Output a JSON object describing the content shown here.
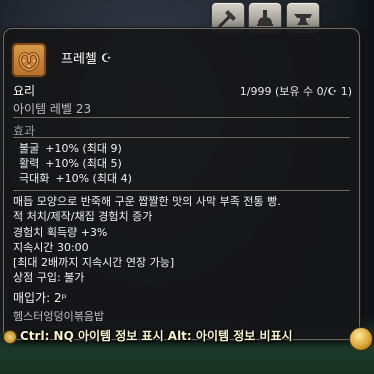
{
  "toolbar": {
    "buttons": [
      {
        "icon": "hammer-icon"
      },
      {
        "icon": "alembic-icon"
      },
      {
        "icon": "anvil-icon"
      }
    ]
  },
  "tooltip": {
    "item_name": "프레첼",
    "hq_mark": "☪",
    "category": "요리",
    "stack_info": "1/999 (보유 수 0/☪ 1)",
    "item_level": "아이템 레벨 23",
    "effects_label": "효과",
    "effects": [
      {
        "stat": "불굴",
        "value": "+10% (최대 9)"
      },
      {
        "stat": "활력",
        "value": "+10% (최대 5)"
      },
      {
        "stat": "극대화",
        "value": "+10% (최대 4)"
      }
    ],
    "description": [
      "매듭 모양으로 반죽해 구운 짭짤한 맛의 사막 부족 전통 빵.",
      "적 처치/제작/채집 경험치 증가",
      "경험치 획득량 +3%",
      "지속시간 30:00",
      "[최대 2배까지 지속시간 연장 가능]",
      "상점 구입: 불가"
    ],
    "sell_price": "매입가: 2ᵖ",
    "crafter_name": "헴스터엉덩이볶음밥"
  },
  "hint_bar": {
    "text": "Ctrl: NQ 아이템 정보 표시 Alt: 아이템 정보 비표시"
  },
  "colors": {
    "panel": "#161618",
    "border": "#6d6a64",
    "hint_text": "#f7f1cf",
    "item_icon": "#c98438"
  }
}
